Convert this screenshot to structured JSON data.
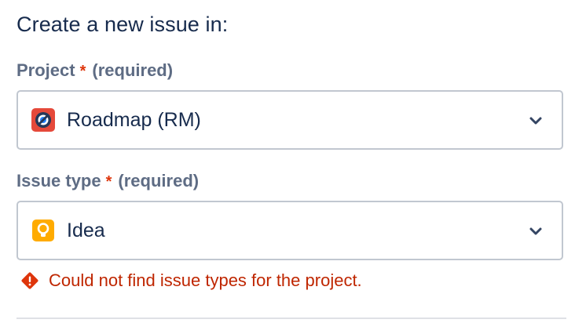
{
  "form": {
    "heading": "Create a new issue in:",
    "project": {
      "label": "Project",
      "required_marker": "*",
      "required_text": "(required)",
      "value": "Roadmap (RM)",
      "icon": "project-avatar-icon"
    },
    "issue_type": {
      "label": "Issue type",
      "required_marker": "*",
      "required_text": "(required)",
      "value": "Idea",
      "icon": "lightbulb-icon"
    },
    "error": {
      "icon": "error-diamond-icon",
      "message": "Could not find issue types for the project."
    }
  },
  "colors": {
    "label": "#5e6c84",
    "required": "#de350b",
    "error": "#bf2600",
    "border": "#c1c7d0",
    "idea_orange": "#ffab00",
    "project_avatar": "#e5493a"
  }
}
